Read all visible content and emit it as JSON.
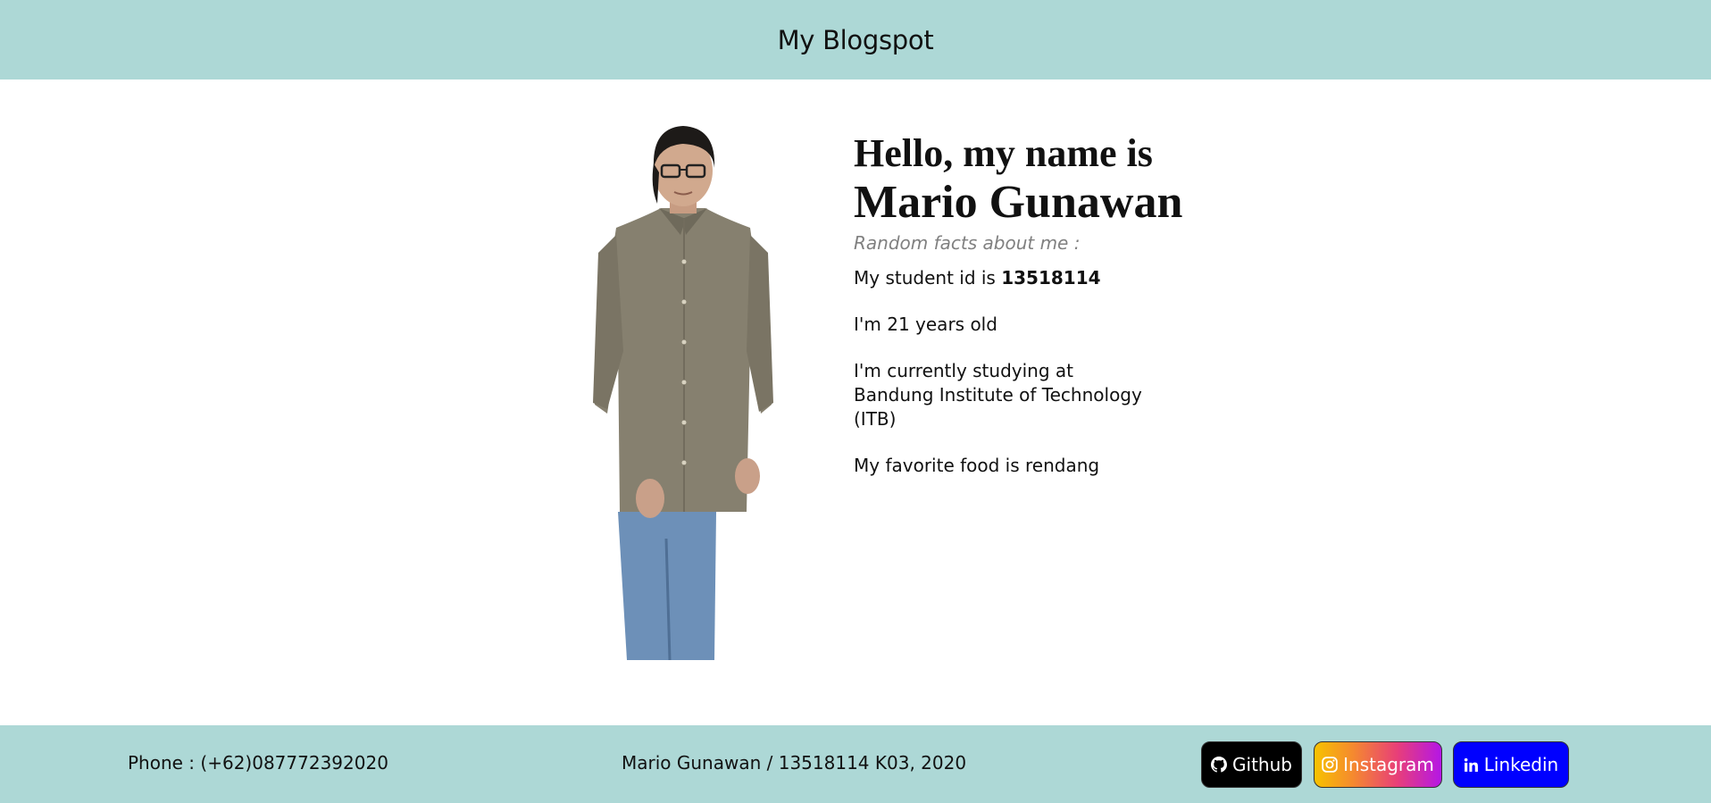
{
  "header": {
    "title": "My Blogspot"
  },
  "intro": {
    "greeting": "Hello, my name is",
    "name": "Mario Gunawan",
    "facts_label": "Random facts about me :",
    "student_id_prefix": "My student id is ",
    "student_id": "13518114",
    "age": "I'm 21 years old",
    "study": "I'm currently studying at Bandung Institute of Technology (ITB)",
    "food": "My favorite food is rendang"
  },
  "footer": {
    "phone": "Phone : (+62)087772392020",
    "credit": "Mario Gunawan / 13518114 K03, 2020",
    "github_label": "Github",
    "instagram_label": "Instagram",
    "linkedin_label": "Linkedin"
  },
  "colors": {
    "header_bg": "#add8d6",
    "footer_bg": "#add8d6",
    "github_bg": "#000000",
    "linkedin_bg": "#0000ff"
  },
  "icons": [
    "github-icon",
    "instagram-icon",
    "linkedin-icon"
  ]
}
